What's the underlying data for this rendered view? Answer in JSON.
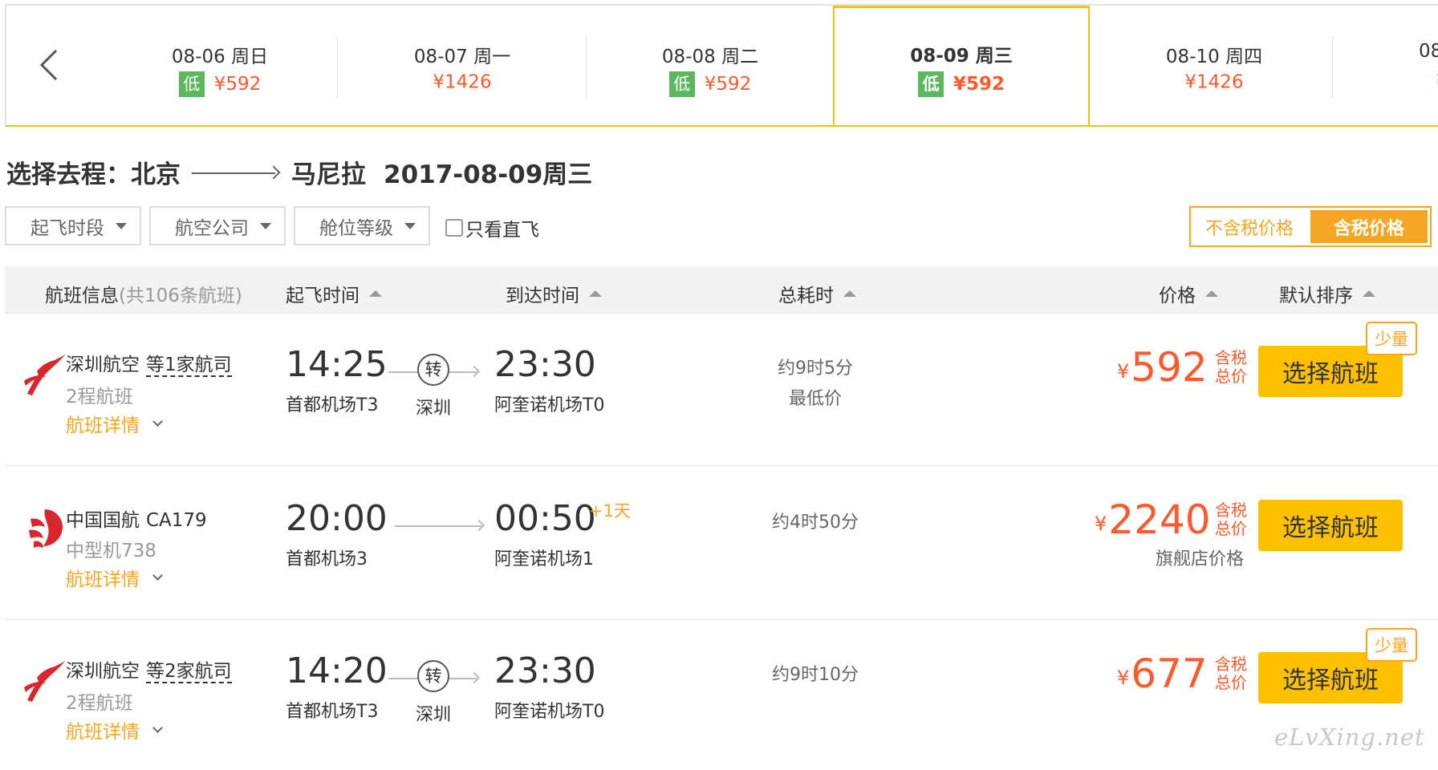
{
  "date_strip": {
    "prev_icon": "chevron-left-icon",
    "dates": [
      {
        "date": "08-06 周日",
        "low": "低",
        "price": "¥592"
      },
      {
        "date": "08-07 周一",
        "low": "",
        "price": "¥1426"
      },
      {
        "date": "08-08 周二",
        "low": "低",
        "price": "¥592"
      },
      {
        "date": "08-09 周三",
        "low": "低",
        "price": "¥592"
      },
      {
        "date": "08-10 周四",
        "low": "",
        "price": "¥1426"
      },
      {
        "date": "08-",
        "low": "",
        "price": "¥"
      }
    ],
    "active_index": 3
  },
  "route": {
    "prefix": "选择去程：",
    "from": "北京",
    "to": "马尼拉",
    "date": "2017-08-09周三"
  },
  "filters": {
    "departure_time": "起飞时段",
    "airline": "航空公司",
    "cabin": "舱位等级",
    "direct_only": "只看直飞"
  },
  "price_toggle": {
    "excl_tax": "不含税价格",
    "incl_tax": "含税价格",
    "active": "incl_tax"
  },
  "table_header": {
    "flight_info": "航班信息",
    "flight_count": "(共106条航班)",
    "depart_time": "起飞时间",
    "arrive_time": "到达时间",
    "total_duration": "总耗时",
    "price": "价格",
    "default_sort": "默认排序"
  },
  "flights": [
    {
      "airline": "深圳航空",
      "share": "等1家航司",
      "flight_no": "",
      "sub": "2程航班",
      "details": "航班详情",
      "depart_time": "14:25",
      "depart_airport": "首都机场T3",
      "transfer": "转",
      "transfer_city": "深圳",
      "arrive_time": "23:30",
      "arrive_plus": "",
      "arrive_airport": "阿奎诺机场T0",
      "duration": "约9时5分",
      "duration_note": "最低价",
      "yen": "¥",
      "price": "592",
      "tax_label": "含税总价",
      "store_note": "",
      "select": "选择航班",
      "badge": "少量"
    },
    {
      "airline": "中国国航",
      "share": "",
      "flight_no": "CA179",
      "sub": "中型机738",
      "details": "航班详情",
      "depart_time": "20:00",
      "depart_airport": "首都机场3",
      "transfer": "",
      "transfer_city": "",
      "arrive_time": "00:50",
      "arrive_plus": "+1天",
      "arrive_airport": "阿奎诺机场1",
      "duration": "约4时50分",
      "duration_note": "",
      "yen": "¥",
      "price": "2240",
      "tax_label": "含税总价",
      "store_note": "旗舰店价格",
      "select": "选择航班",
      "badge": ""
    },
    {
      "airline": "深圳航空",
      "share": "等2家航司",
      "flight_no": "",
      "sub": "2程航班",
      "details": "航班详情",
      "depart_time": "14:20",
      "depart_airport": "首都机场T3",
      "transfer": "转",
      "transfer_city": "深圳",
      "arrive_time": "23:30",
      "arrive_plus": "",
      "arrive_airport": "阿奎诺机场T0",
      "duration": "约9时10分",
      "duration_note": "",
      "yen": "¥",
      "price": "677",
      "tax_label": "含税总价",
      "store_note": "",
      "select": "选择航班",
      "badge": "少量"
    }
  ],
  "watermark": "eLvXing.net",
  "colors": {
    "accent": "#f5a623",
    "active_border": "#f5c400",
    "price": "#ff5a2c",
    "low_badge": "#5cb85c",
    "select_button": "#ffc000"
  }
}
